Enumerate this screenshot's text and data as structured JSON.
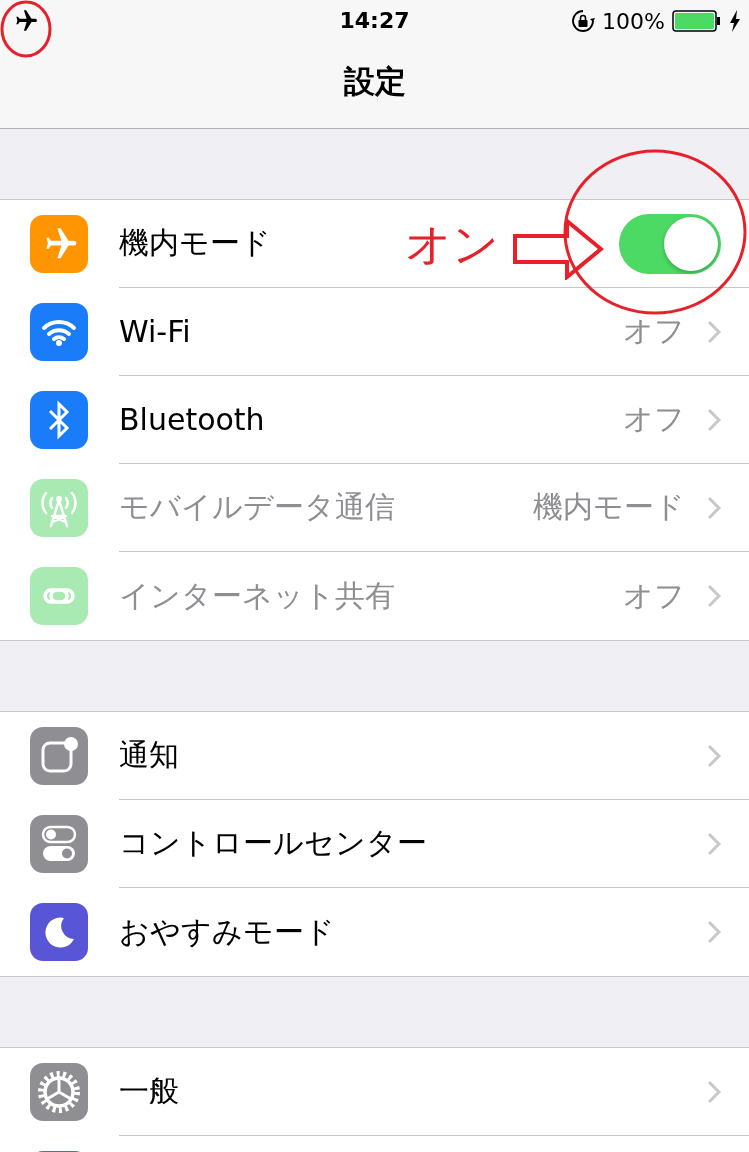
{
  "status_bar": {
    "time": "14:27",
    "battery": "100%",
    "airplane_mode": true
  },
  "nav": {
    "title": "設定"
  },
  "groups": [
    {
      "rows": [
        {
          "kind": "toggle",
          "label": "機内モード",
          "on": true,
          "color": "#ff9500"
        },
        {
          "kind": "disclosure",
          "label": "Wi-Fi",
          "value": "オフ",
          "disabled": false,
          "color": "#1a7cf9"
        },
        {
          "kind": "disclosure",
          "label": "Bluetooth",
          "value": "オフ",
          "disabled": false,
          "color": "#1a7cf9"
        },
        {
          "kind": "disclosure",
          "label": "モバイルデータ通信",
          "value": "機内モード",
          "disabled": true,
          "color": "#a8eab1"
        },
        {
          "kind": "disclosure",
          "label": "インターネット共有",
          "value": "オフ",
          "disabled": true,
          "color": "#a8eab1"
        }
      ]
    },
    {
      "rows": [
        {
          "kind": "disclosure",
          "label": "通知",
          "disabled": false,
          "color": "#8e8e93"
        },
        {
          "kind": "disclosure",
          "label": "コントロールセンター",
          "disabled": false,
          "color": "#8e8e93"
        },
        {
          "kind": "disclosure",
          "label": "おやすみモード",
          "disabled": false,
          "color": "#5856d6"
        }
      ]
    },
    {
      "rows": [
        {
          "kind": "disclosure",
          "label": "一般",
          "disabled": false,
          "color": "#8e8e93"
        },
        {
          "kind": "partial",
          "color": "#1a7cf9"
        }
      ]
    }
  ],
  "annotation": {
    "label": "オン"
  }
}
